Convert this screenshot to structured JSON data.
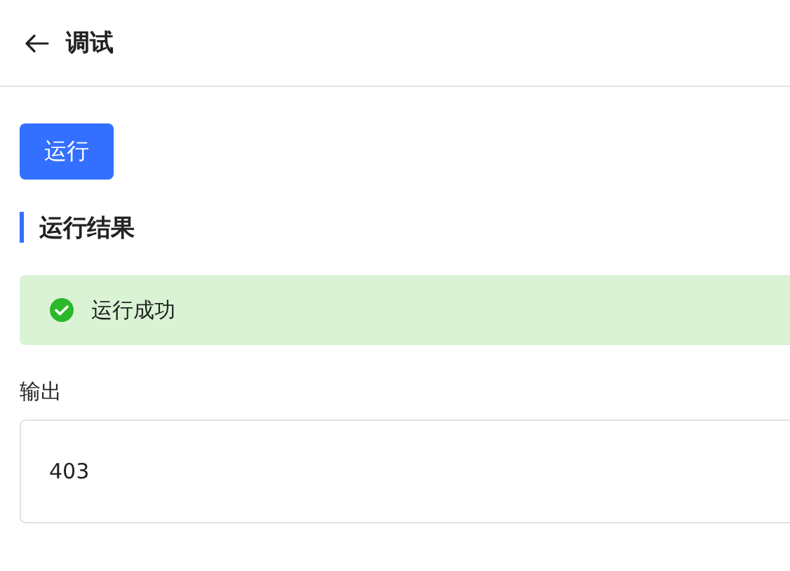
{
  "header": {
    "title": "调试"
  },
  "run_button": {
    "label": "运行"
  },
  "section": {
    "title": "运行结果"
  },
  "result": {
    "success": true,
    "message": "运行成功"
  },
  "output": {
    "label": "输出",
    "value": "403"
  }
}
